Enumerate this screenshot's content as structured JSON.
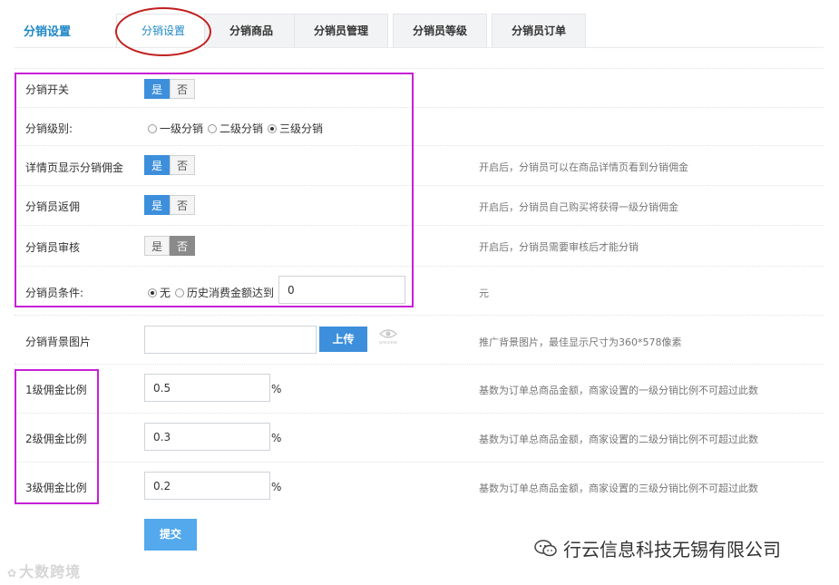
{
  "page_title": "分销设置",
  "tabs": [
    "分销设置",
    "分销商品",
    "分销员管理",
    "分销员等级",
    "分销员订单"
  ],
  "active_tab": 0,
  "fields": {
    "switch": {
      "label": "分销开关",
      "yes": "是",
      "no": "否",
      "value": "是"
    },
    "level": {
      "label": "分销级别:",
      "options": [
        "一级分销",
        "二级分销",
        "三级分销"
      ],
      "selected": "三级分销"
    },
    "detail_commission": {
      "label": "详情页显示分销佣金",
      "yes": "是",
      "no": "否",
      "value": "是",
      "hint": "开启后，分销员可以在商品详情页看到分销佣金"
    },
    "rebate": {
      "label": "分销员返佣",
      "yes": "是",
      "no": "否",
      "value": "是",
      "hint": "开启后，分销员自己购买将获得一级分销佣金"
    },
    "audit": {
      "label": "分销员审核",
      "yes": "是",
      "no": "否",
      "value": "否",
      "hint": "开启后，分销员需要审核后才能分销"
    },
    "condition": {
      "label": "分销员条件:",
      "options": [
        "无",
        "历史消费金额达到"
      ],
      "selected": "无",
      "amount": "0",
      "unit": "元"
    },
    "background": {
      "label": "分销背景图片",
      "upload_label": "上传",
      "preview_label": "preview",
      "hint": "推广背景图片，最佳显示尺寸为360*578像素"
    },
    "level1": {
      "label": "1级佣金比例",
      "value": "0.5",
      "unit": "%",
      "hint": "基数为订单总商品金额，商家设置的一级分销比例不可超过此数"
    },
    "level2": {
      "label": "2级佣金比例",
      "value": "0.3",
      "unit": "%",
      "hint": "基数为订单总商品金额，商家设置的二级分销比例不可超过此数"
    },
    "level3": {
      "label": "3级佣金比例",
      "value": "0.2",
      "unit": "%",
      "hint": "基数为订单总商品金额，商家设置的三级分销比例不可超过此数"
    }
  },
  "submit_label": "提交",
  "watermark_left": "大数跨境",
  "watermark_right": "行云信息科技无锡有限公司",
  "colors": {
    "accent": "#3d8fdc",
    "annotation_red": "#c0201f",
    "annotation_magenta": "#c81fd5"
  }
}
